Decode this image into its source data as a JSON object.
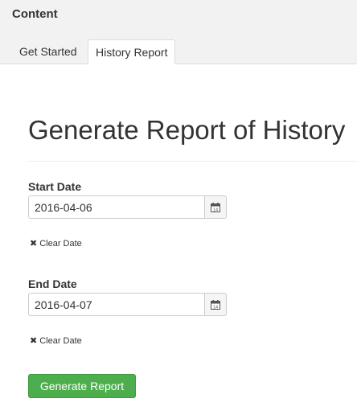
{
  "topbar": {
    "title": "Content",
    "tabs": [
      {
        "label": "Get Started",
        "active": false
      },
      {
        "label": "History Report",
        "active": true
      }
    ]
  },
  "main": {
    "heading": "Generate Report of History",
    "start_date": {
      "label": "Start Date",
      "value": "2016-04-06",
      "calendar_icon": "calendar-icon",
      "clear_label": "Clear Date",
      "clear_icon": "close-icon"
    },
    "end_date": {
      "label": "End Date",
      "value": "2016-04-07",
      "calendar_icon": "calendar-icon",
      "clear_label": "Clear Date",
      "clear_icon": "close-icon"
    },
    "generate_label": "Generate Report"
  },
  "colors": {
    "accent_green": "#4cae4c",
    "topbar_bg": "#f2f2f2"
  }
}
